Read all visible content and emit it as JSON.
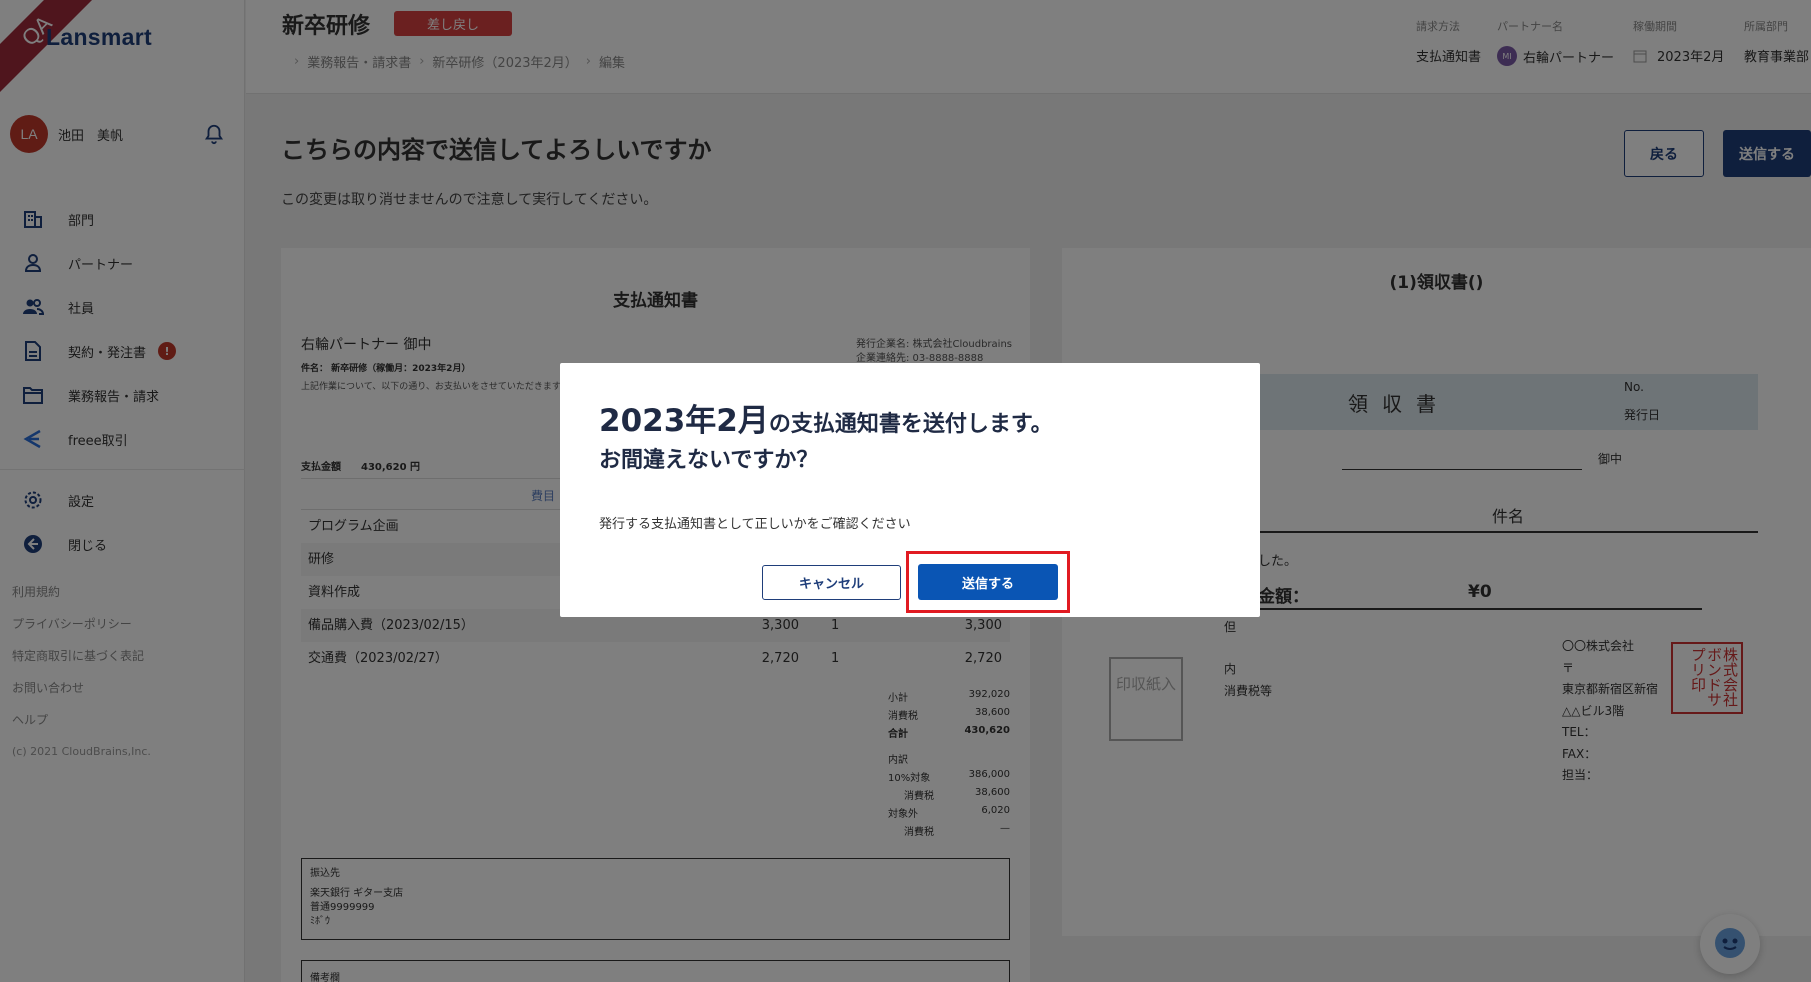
{
  "sidebar": {
    "ribbon": "QA",
    "logo": "Lansmart",
    "user": {
      "initials": "LA",
      "name": "池田　美帆"
    },
    "nav": [
      {
        "label": "部門",
        "icon": "building-icon"
      },
      {
        "label": "パートナー",
        "icon": "person-icon"
      },
      {
        "label": "社員",
        "icon": "people-icon"
      },
      {
        "label": "契約・発注書",
        "icon": "document-icon",
        "badge": "!"
      },
      {
        "label": "業務報告・請求",
        "icon": "folder-icon"
      },
      {
        "label": "freee取引",
        "icon": "freee-icon"
      }
    ],
    "settings_label": "設定",
    "close_label": "閉じる",
    "footer": [
      "利用規約",
      "プライバシーポリシー",
      "特定商取引に基づく表記",
      "お問い合わせ",
      "ヘルプ"
    ],
    "copyright": "(c) 2021 CloudBrains,Inc."
  },
  "header": {
    "title": "新卒研修",
    "status": "差し戻し",
    "breadcrumb": [
      "業務報告・請求書",
      "新卒研修（2023年2月）",
      "編集"
    ],
    "meta": {
      "billing_method_label": "請求方法",
      "billing_method": "支払通知書",
      "partner_label": "パートナー名",
      "partner_initials": "MI",
      "partner": "右輪パートナー",
      "period_label": "稼働期間",
      "period": "2023年2月",
      "dept_label": "所属部門",
      "dept": "教育事業部"
    }
  },
  "main": {
    "heading": "こちらの内容で送信してよろしいですか",
    "subtext": "この変更は取り消せませんので注意して実行してください。",
    "back_label": "戻る",
    "send_label": "送信する"
  },
  "doc_left": {
    "title": "支払通知書",
    "partner": "右輪パートナー 御中",
    "subject": "件名： 新卒研修（稼働月：2023年2月）",
    "note": "上記作業について、以下の通り、お支払いをさせていただきます。",
    "issuer_name": "発行企業名: 株式会社Cloudbrains",
    "issuer_tel": "企業連絡先: 03-8888-8888",
    "amount_label": "支払金額",
    "amount": "430,620 円",
    "col_item": "費目",
    "rows": [
      {
        "item": "プログラム企画",
        "price": "",
        "qty": "",
        "total": ""
      },
      {
        "item": "研修",
        "price": "",
        "qty": "",
        "total": ""
      },
      {
        "item": "資料作成",
        "price": "",
        "qty": "",
        "total": ""
      },
      {
        "item": "備品購入費（2023/02/15）",
        "price": "3,300",
        "qty": "1",
        "total": "3,300"
      },
      {
        "item": "交通費（2023/02/27）",
        "price": "2,720",
        "qty": "1",
        "total": "2,720"
      }
    ],
    "summary": [
      {
        "label": "小計",
        "value": "392,020"
      },
      {
        "label": "消費税",
        "value": "38,600"
      },
      {
        "label": "合計",
        "value": "430,620"
      },
      {
        "label": "内訳",
        "value": ""
      },
      {
        "label": "10%対象",
        "value": "386,000"
      },
      {
        "label": "消費税",
        "value": "38,600"
      },
      {
        "label": "対象外",
        "value": "6,020"
      },
      {
        "label": "消費税",
        "value": "—"
      }
    ],
    "bank_label": "振込先",
    "bank_line1": "楽天銀行 ギター支店",
    "bank_line2": "普通9999999",
    "bank_line3": "ﾐﾎﾞｳ",
    "notes_label": "備考欄"
  },
  "doc_right": {
    "title": "(1)領収書()",
    "receipt": "領収書",
    "no_label": "No.",
    "date_label": "発行日",
    "onchu": "御中",
    "kenmei": "件名",
    "text1": "した。",
    "amount_label": "金額：",
    "amount": "¥0",
    "tada": "但",
    "stamp": "印収紙入",
    "uchi": "内",
    "tax_label": "消費税等",
    "company_lines": [
      "〇〇株式会社",
      "〒",
      "東京都新宿区新宿",
      "△△ビル3階",
      "TEL：",
      "FAX：",
      "担当："
    ],
    "seal": "株式会社ボンドサプリ印"
  },
  "modal": {
    "title_year": "2023年2月",
    "title_rest": "の支払通知書を送付します。",
    "title_line2": "お間違えないですか？",
    "body": "発行する支払通知書として正しいかをご確認ください",
    "cancel_label": "キャンセル",
    "send_label": "送信する"
  }
}
